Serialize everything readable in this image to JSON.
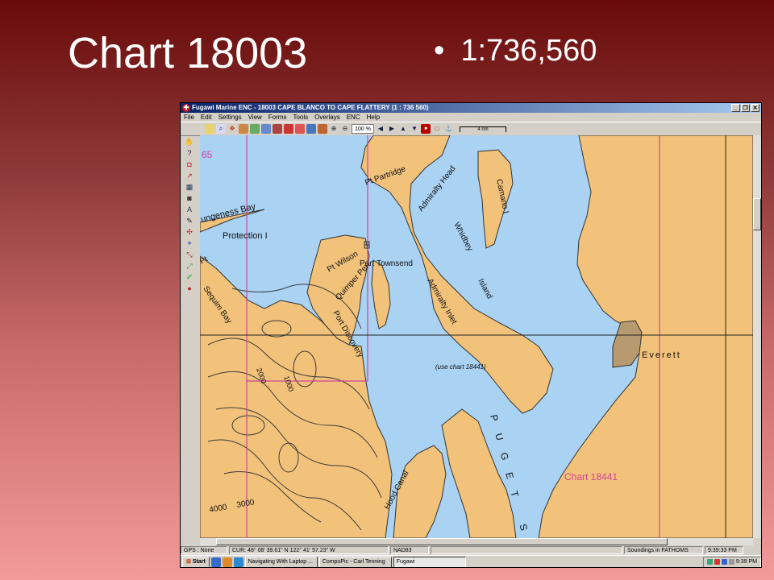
{
  "slide": {
    "title": "Chart 18003",
    "bullet": "1:736,560"
  },
  "window": {
    "title": "Fugawi Marine ENC - 18003  CAPE BLANCO TO CAPE FLATTERY  (1 : 736 560)",
    "menu": [
      "File",
      "Edit",
      "Settings",
      "View",
      "Forms",
      "Tools",
      "Overlays",
      "ENC",
      "Help"
    ],
    "zoom": "100 %",
    "scale_label": "4 nm"
  },
  "map": {
    "labels": {
      "tile_number": "65",
      "dungeness_bay": "ungeness Bay",
      "protection": "Protection I",
      "pt": "Pt",
      "sequim_bay": "Sequim Bay",
      "pt_partridge": "Pt  Partridge",
      "admiralty_head": "Admiralty Head",
      "camano": "Camano I",
      "whidbey": "Whidbey",
      "island": "Island",
      "pt_wilson": "Pt Wilson",
      "quimper_pen": "Quimper Pen",
      "port_discovery": "Port Discovery",
      "port_townsend": "Port Townsend",
      "admiralty_inlet": "Admiralty Inlet",
      "use_chart": "(use chart 18441)",
      "everett": "Everett",
      "puget_s": "PUGET S",
      "hood_canal": "Hood Canal",
      "chart_18441": "Chart 18441",
      "contour_2000": "2000",
      "contour_1000": "1000",
      "contour_4000": "4000",
      "contour_3000": "3000"
    }
  },
  "status": {
    "gps": "GPS : None",
    "cursor": "CUR: 48° 08' 39.61\" N 122° 41' 57.23\" W",
    "datum": "NAD83",
    "soundings": "Soundings in FATHOMS",
    "clock": "9:39:33 PM"
  },
  "taskbar": {
    "start": "Start",
    "tasks": [
      "Navigating With Laptop ...",
      "CompuPic - Carl Tenning",
      "Fugawi"
    ],
    "time": "9:39 PM"
  },
  "colors": {
    "land": "#f2c27a",
    "water": "#a9d2f3",
    "magenta": "#d0449a"
  }
}
